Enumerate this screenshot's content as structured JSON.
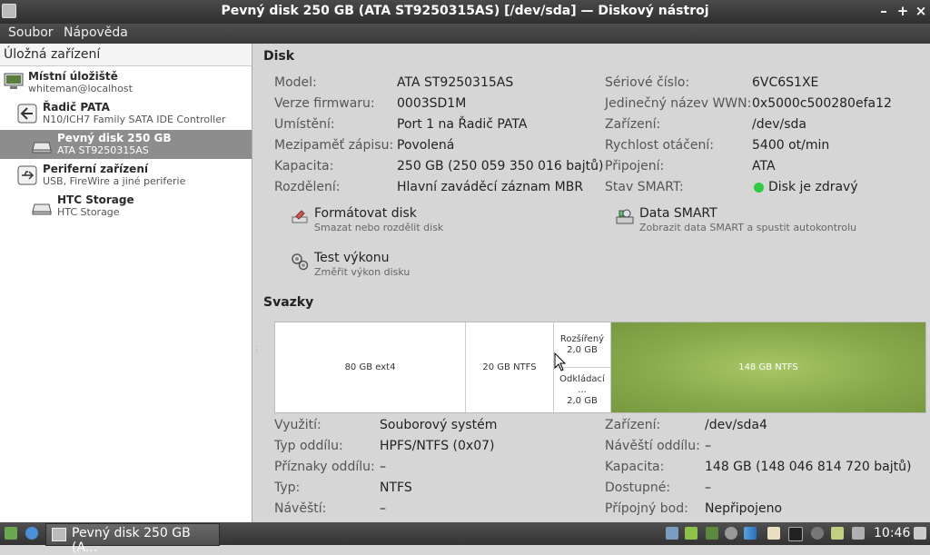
{
  "window": {
    "title": "Pevný disk 250 GB (ATA ST9250315AS) [/dev/sda] — Diskový nástroj",
    "minimize": "–",
    "maximize": "+",
    "close": "×"
  },
  "menu": {
    "file": "Soubor",
    "help": "Nápověda"
  },
  "sidebar": {
    "header": "Úložná zařízení",
    "items": [
      {
        "title": "Místní úložiště",
        "subtitle": "whiteman@localhost"
      },
      {
        "title": "Řadič PATA",
        "subtitle": "N10/ICH7 Family SATA IDE Controller"
      },
      {
        "title": "Pevný disk 250 GB",
        "subtitle": "ATA ST9250315AS"
      },
      {
        "title": "Periferní zařízení",
        "subtitle": "USB, FireWire a jiné periferie"
      },
      {
        "title": "HTC Storage",
        "subtitle": "HTC Storage"
      }
    ]
  },
  "disk": {
    "heading": "Disk",
    "left": [
      {
        "label": "Model:",
        "value": "ATA ST9250315AS"
      },
      {
        "label": "Verze firmwaru:",
        "value": "0003SD1M"
      },
      {
        "label": "Umístění:",
        "value": "Port 1 na Řadič PATA"
      },
      {
        "label": "Mezipaměť zápisu:",
        "value": "Povolená"
      },
      {
        "label": "Kapacita:",
        "value": "250 GB (250 059 350 016 bajtů)"
      },
      {
        "label": "Rozdělení:",
        "value": "Hlavní zaváděcí záznam MBR"
      }
    ],
    "right": [
      {
        "label": "Sériové číslo:",
        "value": "6VC6S1XE"
      },
      {
        "label": "Jedinečný název WWN:",
        "value": "0x5000c500280efa12"
      },
      {
        "label": "Zařízení:",
        "value": "/dev/sda"
      },
      {
        "label": "Rychlost otáčení:",
        "value": "5400 ot/min"
      },
      {
        "label": "Připojení:",
        "value": "ATA"
      },
      {
        "label": "Stav SMART:",
        "value": "Disk je zdravý"
      }
    ],
    "actions": {
      "format": {
        "title": "Formátovat disk",
        "subtitle": "Smazat nebo rozdělit disk"
      },
      "smart": {
        "title": "Data SMART",
        "subtitle": "Zobrazit data SMART a spustit autokontrolu"
      },
      "bench": {
        "title": "Test výkonu",
        "subtitle": "Změřit výkon disku"
      }
    }
  },
  "volumes": {
    "heading": "Svazky",
    "segments": [
      {
        "label": "80 GB ext4"
      },
      {
        "label": "20 GB NTFS"
      },
      {
        "label": "Rozšířený\n2,0 GB"
      },
      {
        "label": "Odkládací ...\n2,0 GB"
      },
      {
        "label": "148 GB NTFS"
      }
    ],
    "left": [
      {
        "label": "Využití:",
        "value": "Souborový systém"
      },
      {
        "label": "Typ oddílu:",
        "value": "HPFS/NTFS (0x07)"
      },
      {
        "label": "Příznaky oddílu:",
        "value": "–"
      },
      {
        "label": "Typ:",
        "value": "NTFS"
      },
      {
        "label": "Návěští:",
        "value": "–"
      }
    ],
    "right": [
      {
        "label": "Zařízení:",
        "value": "/dev/sda4"
      },
      {
        "label": "Návěští oddílu:",
        "value": "–"
      },
      {
        "label": "Kapacita:",
        "value": "148 GB (148 046 814 720 bajtů)"
      },
      {
        "label": "Dostupné:",
        "value": "–"
      },
      {
        "label": "Přípojný bod:",
        "value": "Nepřipojeno"
      }
    ]
  },
  "taskbar": {
    "task_label": "Pevný disk 250 GB (A...",
    "clock": "10:46"
  },
  "colors": {
    "accent": "#86a84a",
    "smart_ok": "#2ecc40"
  }
}
